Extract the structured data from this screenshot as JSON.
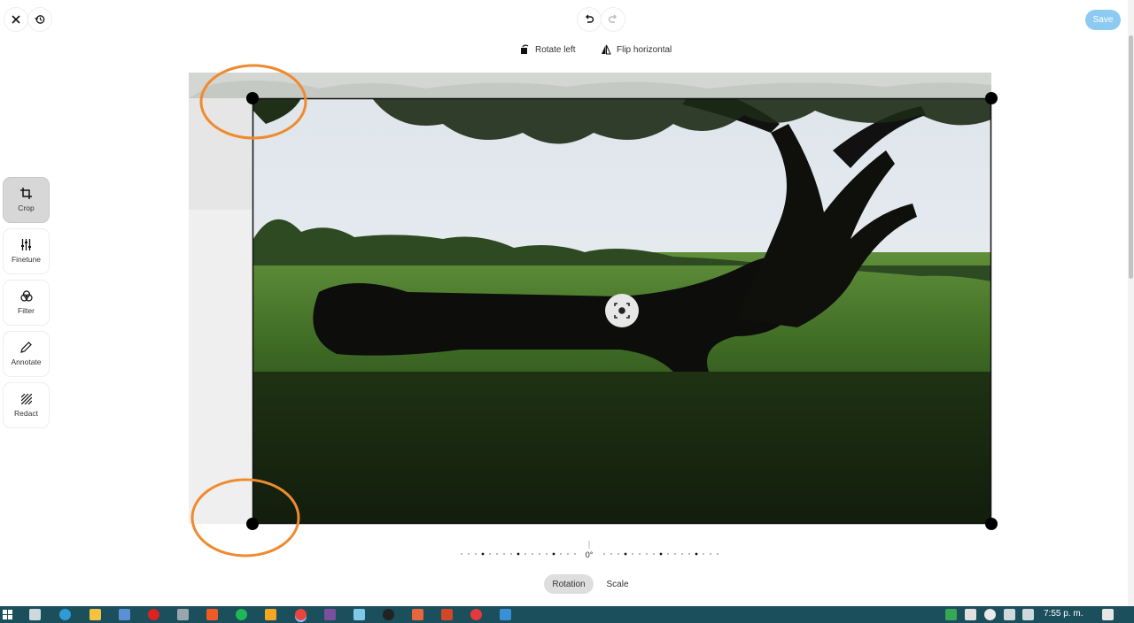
{
  "toolbar": {
    "save_label": "Save",
    "rotate_left_label": "Rotate left",
    "flip_horizontal_label": "Flip horizontal"
  },
  "sidebar": {
    "items": [
      {
        "label": "Crop",
        "icon": "crop-icon",
        "active": true
      },
      {
        "label": "Finetune",
        "icon": "sliders-icon",
        "active": false
      },
      {
        "label": "Filter",
        "icon": "filter-icon",
        "active": false
      },
      {
        "label": "Annotate",
        "icon": "pencil-icon",
        "active": false
      },
      {
        "label": "Redact",
        "icon": "redact-icon",
        "active": false
      }
    ]
  },
  "rotation": {
    "value_label": "0°"
  },
  "bottom_tabs": [
    {
      "label": "Rotation",
      "active": true
    },
    {
      "label": "Scale",
      "active": false
    }
  ],
  "taskbar": {
    "clock": "7:55 p. m."
  },
  "colors": {
    "save_button": "#8ccaf2",
    "annotation_circle": "#f08a2e",
    "taskbar": "#1b4f5c",
    "active_tool": "#d7d7d7"
  }
}
